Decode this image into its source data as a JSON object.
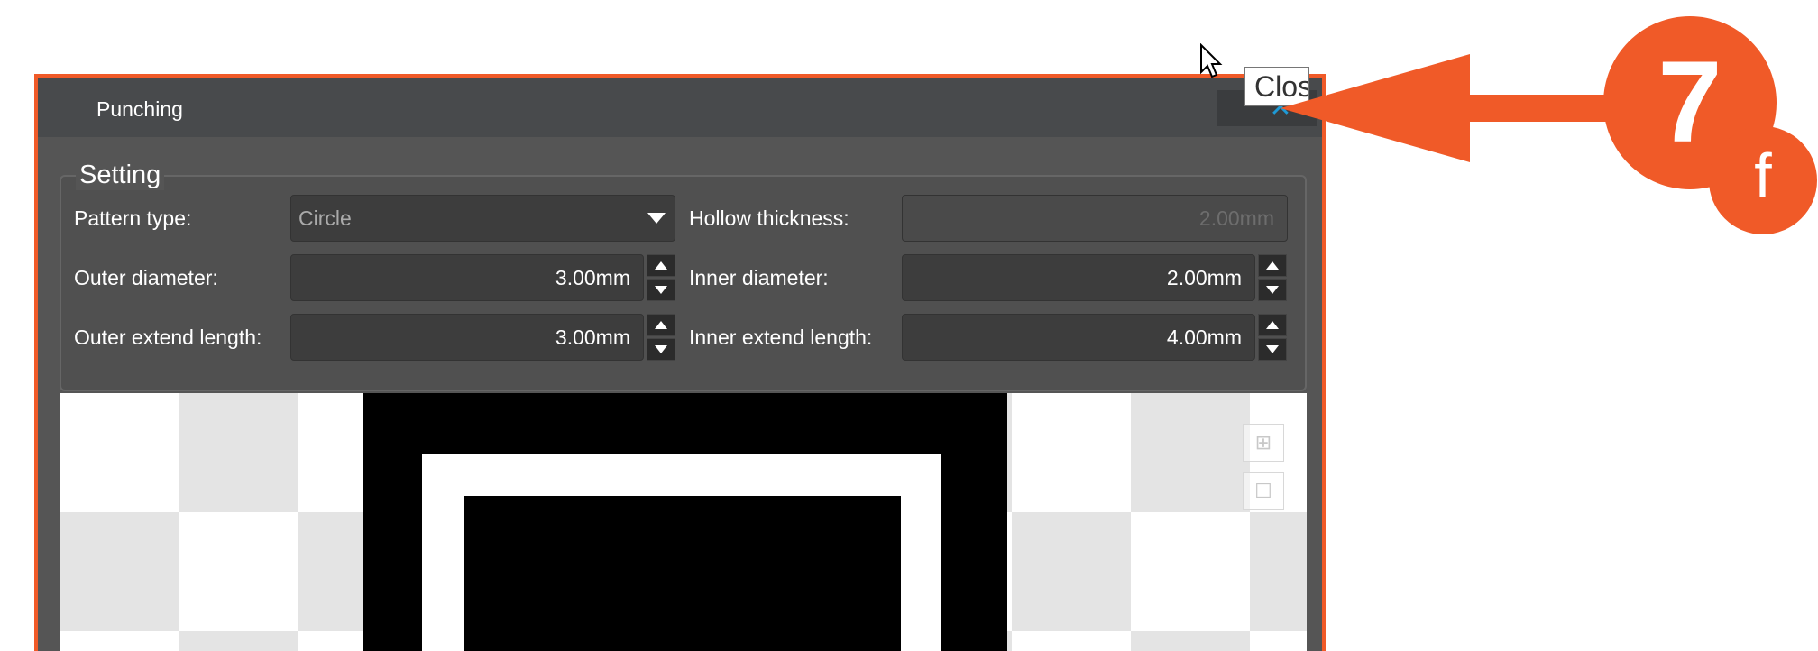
{
  "dialog": {
    "title": "Punching",
    "close_icon": "close-icon",
    "close_tooltip": "Close"
  },
  "setting": {
    "group_label": "Setting",
    "pattern_type": {
      "label": "Pattern type:",
      "value": "Circle"
    },
    "hollow_thickness": {
      "label": "Hollow thickness:",
      "value": "2.00mm",
      "disabled": true
    },
    "outer_diameter": {
      "label": "Outer diameter:",
      "value": "3.00mm"
    },
    "inner_diameter": {
      "label": "Inner diameter:",
      "value": "2.00mm"
    },
    "outer_extend_length": {
      "label": "Outer extend length:",
      "value": "3.00mm"
    },
    "inner_extend_length": {
      "label": "Inner extend length:",
      "value": "4.00mm"
    }
  },
  "preview": {
    "tools": [
      "grid-icon",
      "square-icon"
    ]
  },
  "callout": {
    "step": "7",
    "sub": "f",
    "color": "#f05a28"
  },
  "colors": {
    "accent": "#f05a28",
    "close_icon": "#1e9ad6",
    "dialog_bg": "#555555"
  }
}
